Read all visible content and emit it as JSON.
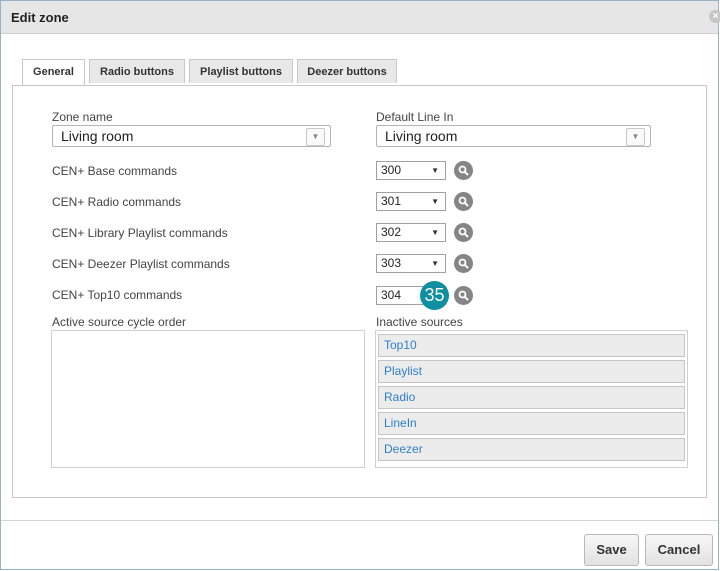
{
  "dialog": {
    "title": "Edit zone"
  },
  "tabs": [
    {
      "label": "General"
    },
    {
      "label": "Radio buttons"
    },
    {
      "label": "Playlist buttons"
    },
    {
      "label": "Deezer buttons"
    }
  ],
  "zone_name": {
    "label": "Zone name",
    "value": "Living room"
  },
  "default_line_in": {
    "label": "Default Line In",
    "value": "Living room"
  },
  "commands": [
    {
      "label": "CEN+ Base commands",
      "value": "300"
    },
    {
      "label": "CEN+ Radio commands",
      "value": "301"
    },
    {
      "label": "CEN+ Library Playlist commands",
      "value": "302"
    },
    {
      "label": "CEN+ Deezer Playlist commands",
      "value": "303"
    },
    {
      "label": "CEN+ Top10 commands",
      "value": "304"
    }
  ],
  "callout_badge": "35",
  "active_sources": {
    "label": "Active source cycle order",
    "items": []
  },
  "inactive_sources": {
    "label": "Inactive sources",
    "items": [
      "Top10",
      "Playlist",
      "Radio",
      "LineIn",
      "Deezer"
    ]
  },
  "footer": {
    "save_label": "Save",
    "cancel_label": "Cancel"
  },
  "colors": {
    "link_blue": "#2f80c8",
    "badge_teal": "#0f8f9f"
  }
}
